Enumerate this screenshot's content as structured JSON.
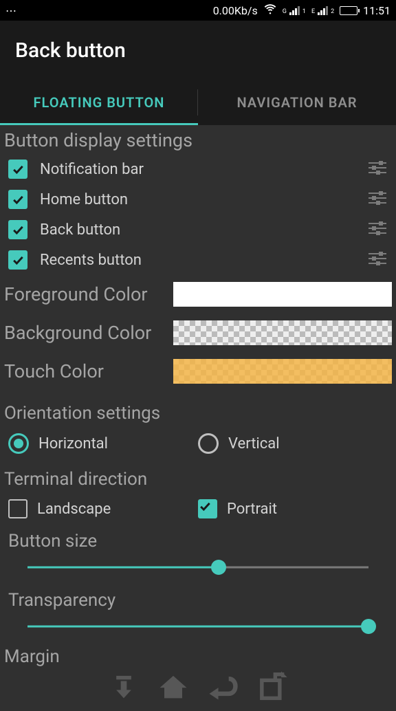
{
  "status": {
    "net_speed": "0.00Kb/s",
    "sig1": "G",
    "sig2": "E",
    "clock": "11:51"
  },
  "header": {
    "title": "Back button"
  },
  "tabs": {
    "floating": "FLOATING BUTTON",
    "nav": "NAVIGATION BAR"
  },
  "display": {
    "heading": "Button display settings",
    "items": [
      {
        "label": "Notification bar",
        "checked": true
      },
      {
        "label": "Home button",
        "checked": true
      },
      {
        "label": "Back button",
        "checked": true
      },
      {
        "label": "Recents button",
        "checked": true
      }
    ]
  },
  "colors": {
    "fg_label": "Foreground Color",
    "bg_label": "Background Color",
    "touch_label": "Touch Color",
    "fg_value": "#ffffff",
    "bg_value": "transparent",
    "touch_value": "#f4b342cc"
  },
  "orientation": {
    "heading": "Orientation settings",
    "horizontal": "Horizontal",
    "vertical": "Vertical",
    "selected": "horizontal"
  },
  "terminal": {
    "heading": "Terminal direction",
    "landscape": "Landscape",
    "portrait": "Portrait",
    "landscape_checked": false,
    "portrait_checked": true
  },
  "sliders": {
    "size_label": "Button size",
    "size_pct": 56,
    "transparency_label": "Transparency",
    "transparency_pct": 100,
    "margin_label": "Margin"
  }
}
